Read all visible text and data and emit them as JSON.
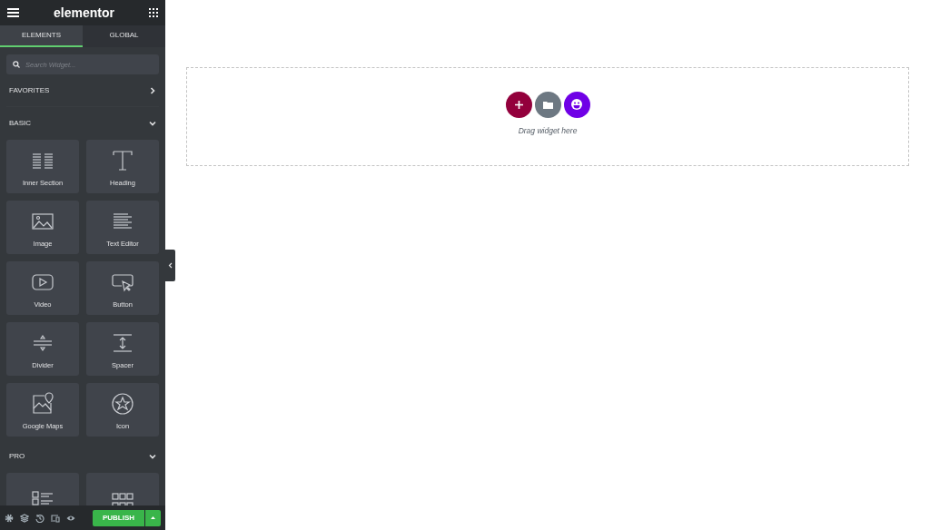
{
  "header": {
    "title": "elementor"
  },
  "tabs": [
    {
      "label": "ELEMENTS",
      "selected": true
    },
    {
      "label": "GLOBAL",
      "selected": false
    }
  ],
  "search": {
    "placeholder": "Search Widget..."
  },
  "sections": [
    {
      "title": "FAVORITES",
      "expanded": false
    },
    {
      "title": "BASIC",
      "expanded": true,
      "widgets": [
        {
          "kind": "inner-section",
          "label": "Inner Section"
        },
        {
          "kind": "heading",
          "label": "Heading"
        },
        {
          "kind": "image",
          "label": "Image"
        },
        {
          "kind": "text-editor",
          "label": "Text Editor"
        },
        {
          "kind": "video",
          "label": "Video"
        },
        {
          "kind": "button",
          "label": "Button"
        },
        {
          "kind": "divider",
          "label": "Divider"
        },
        {
          "kind": "spacer",
          "label": "Spacer"
        },
        {
          "kind": "map",
          "label": "Google Maps"
        },
        {
          "kind": "icon",
          "label": "Icon"
        }
      ]
    },
    {
      "title": "PRO",
      "expanded": true,
      "widgets": [
        {
          "kind": "list"
        },
        {
          "kind": "grid"
        }
      ]
    }
  ],
  "footer": {
    "publish": "PUBLISH"
  },
  "canvas": {
    "drop_hint": "Drag widget here"
  }
}
